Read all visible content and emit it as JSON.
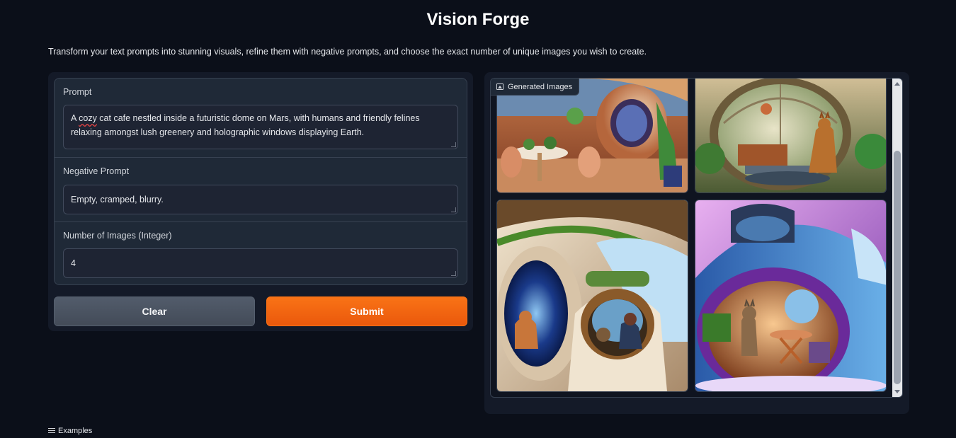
{
  "app": {
    "title": "Vision Forge",
    "description": "Transform your text prompts into stunning visuals, refine them with negative prompts, and choose the exact number of unique images you wish to create."
  },
  "form": {
    "prompt": {
      "label": "Prompt",
      "value_prefix": "A ",
      "value_misspelled": "cozy",
      "value_line1_rest": " cat cafe nestled inside a futuristic dome on Mars, with humans and friendly felines",
      "value_line2": "relaxing amongst lush greenery and holographic windows displaying Earth."
    },
    "negative_prompt": {
      "label": "Negative Prompt",
      "value": "Empty, cramped, blurry."
    },
    "num_images": {
      "label": "Number of Images (Integer)",
      "value": "4"
    },
    "clear_label": "Clear",
    "submit_label": "Submit"
  },
  "gallery": {
    "label": "Generated Images",
    "icon": "image-icon",
    "image_count": 4
  },
  "examples": {
    "label": "Examples",
    "icon": "list-icon"
  },
  "colors": {
    "background": "#0b0f19",
    "panel": "#141a28",
    "accent": "#f97316"
  }
}
